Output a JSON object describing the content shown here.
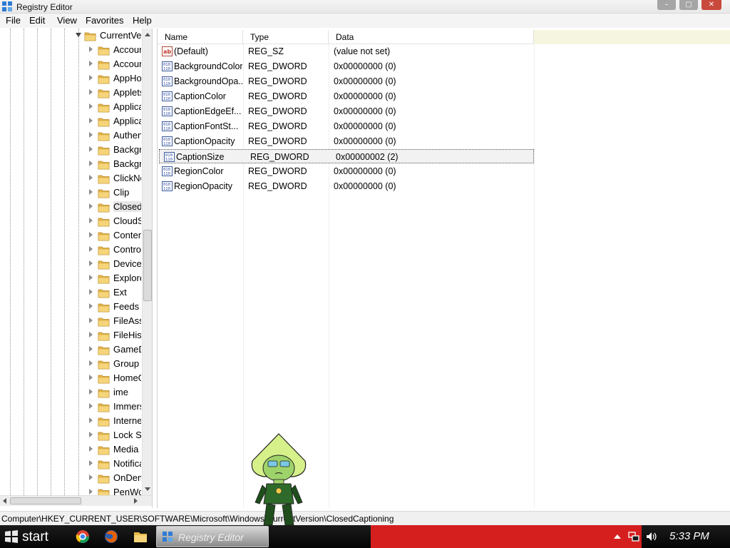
{
  "window": {
    "title": "Registry Editor",
    "controls": {
      "minimize": "–",
      "maximize": "▢",
      "close": "✕"
    }
  },
  "menu": [
    "File",
    "Edit",
    "View",
    "Favorites",
    "Help"
  ],
  "tree": {
    "expanded_node": "CurrentVersion",
    "selected_node": "ClosedCaptioning",
    "children": [
      "AccountPicture",
      "AccountState",
      "AppHost",
      "Applets",
      "ApplicationAssociationToasts",
      "ApplicationFrame",
      "Authentication",
      "BackgroundAccessApplications",
      "BackgroundModel",
      "ClickNote",
      "Clip",
      "ClosedCaptioning",
      "CloudStore",
      "ContentDeliveryManager",
      "Control Panel",
      "DeviceAccess",
      "Explorer",
      "Ext",
      "Feeds",
      "FileAssociations",
      "FileHistory",
      "GameDVR",
      "Group Policy",
      "HomeGroup",
      "ime",
      "ImmersiveShell",
      "Internet Settings",
      "Lock Screen",
      "Media Center",
      "Notifications",
      "OnDemandInterop",
      "PenWorkspace"
    ]
  },
  "list": {
    "columns": [
      "Name",
      "Type",
      "Data"
    ],
    "rows": [
      {
        "name": "(Default)",
        "type": "REG_SZ",
        "data": "(value not set)",
        "icon": "string-value-icon"
      },
      {
        "name": "BackgroundColor",
        "type": "REG_DWORD",
        "data": "0x00000000 (0)",
        "icon": "dword-value-icon"
      },
      {
        "name": "BackgroundOpa...",
        "type": "REG_DWORD",
        "data": "0x00000000 (0)",
        "icon": "dword-value-icon"
      },
      {
        "name": "CaptionColor",
        "type": "REG_DWORD",
        "data": "0x00000000 (0)",
        "icon": "dword-value-icon"
      },
      {
        "name": "CaptionEdgeEf...",
        "type": "REG_DWORD",
        "data": "0x00000000 (0)",
        "icon": "dword-value-icon"
      },
      {
        "name": "CaptionFontSt...",
        "type": "REG_DWORD",
        "data": "0x00000000 (0)",
        "icon": "dword-value-icon"
      },
      {
        "name": "CaptionOpacity",
        "type": "REG_DWORD",
        "data": "0x00000000 (0)",
        "icon": "dword-value-icon"
      },
      {
        "name": "CaptionSize",
        "type": "REG_DWORD",
        "data": "0x00000002 (2)",
        "icon": "dword-value-icon",
        "selected": true
      },
      {
        "name": "RegionColor",
        "type": "REG_DWORD",
        "data": "0x00000000 (0)",
        "icon": "dword-value-icon"
      },
      {
        "name": "RegionOpacity",
        "type": "REG_DWORD",
        "data": "0x00000000 (0)",
        "icon": "dword-value-icon"
      }
    ]
  },
  "status_bar": {
    "path": "Computer\\HKEY_CURRENT_USER\\SOFTWARE\\Microsoft\\Windows\\CurrentVersion\\ClosedCaptioning"
  },
  "taskbar": {
    "start_label": "start",
    "pinned": [
      "chrome-icon",
      "firefox-icon",
      "file-explorer-icon"
    ],
    "active_task": "Registry Editor",
    "clock": "5:33 PM",
    "tray": [
      "show-hidden-icons-arrow",
      "network-icon",
      "volume-icon"
    ]
  },
  "colors": {
    "folder": "#e8b84a",
    "taskbar": "#0a0a0a",
    "taskbar_accent": "#d51f1f",
    "close_button": "#c84a3c",
    "header_fill": "#f6f6e0"
  }
}
